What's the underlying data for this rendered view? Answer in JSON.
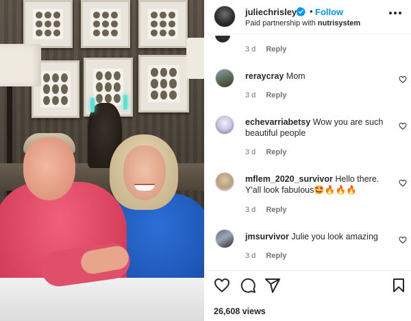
{
  "post": {
    "username": "juliechrisley",
    "follow_label": "Follow",
    "separator": "•",
    "partnership_prefix": "Paid partnership with",
    "partner": "nutrisystem",
    "verified_color": "#0095f6"
  },
  "comments": [
    {
      "username": "",
      "text": "",
      "time": "3 d",
      "reply_label": "Reply"
    },
    {
      "username": "reraycray",
      "text": "Mom",
      "time": "3 d",
      "reply_label": "Reply"
    },
    {
      "username": "echevarriabetsy",
      "text": "Wow you are such beautiful people",
      "time": "3 d",
      "reply_label": "Reply"
    },
    {
      "username": "mflem_2020_survivor",
      "text": "Hello there. Y'all look fabulous🤩🔥🔥🔥",
      "time": "3 d",
      "reply_label": "Reply"
    },
    {
      "username": "jmsurvivor",
      "text": "Julie you look amazing",
      "time": "3 d",
      "reply_label": "Reply"
    }
  ],
  "footer": {
    "views": "26,608 views"
  },
  "icons": {
    "verified": "verified-badge-icon",
    "more": "more-options-icon",
    "like": "heart-icon",
    "comment": "comment-icon",
    "share": "share-icon",
    "save": "bookmark-icon"
  },
  "colors": {
    "follow": "#0095f6",
    "text": "#262626",
    "meta": "#737373"
  }
}
